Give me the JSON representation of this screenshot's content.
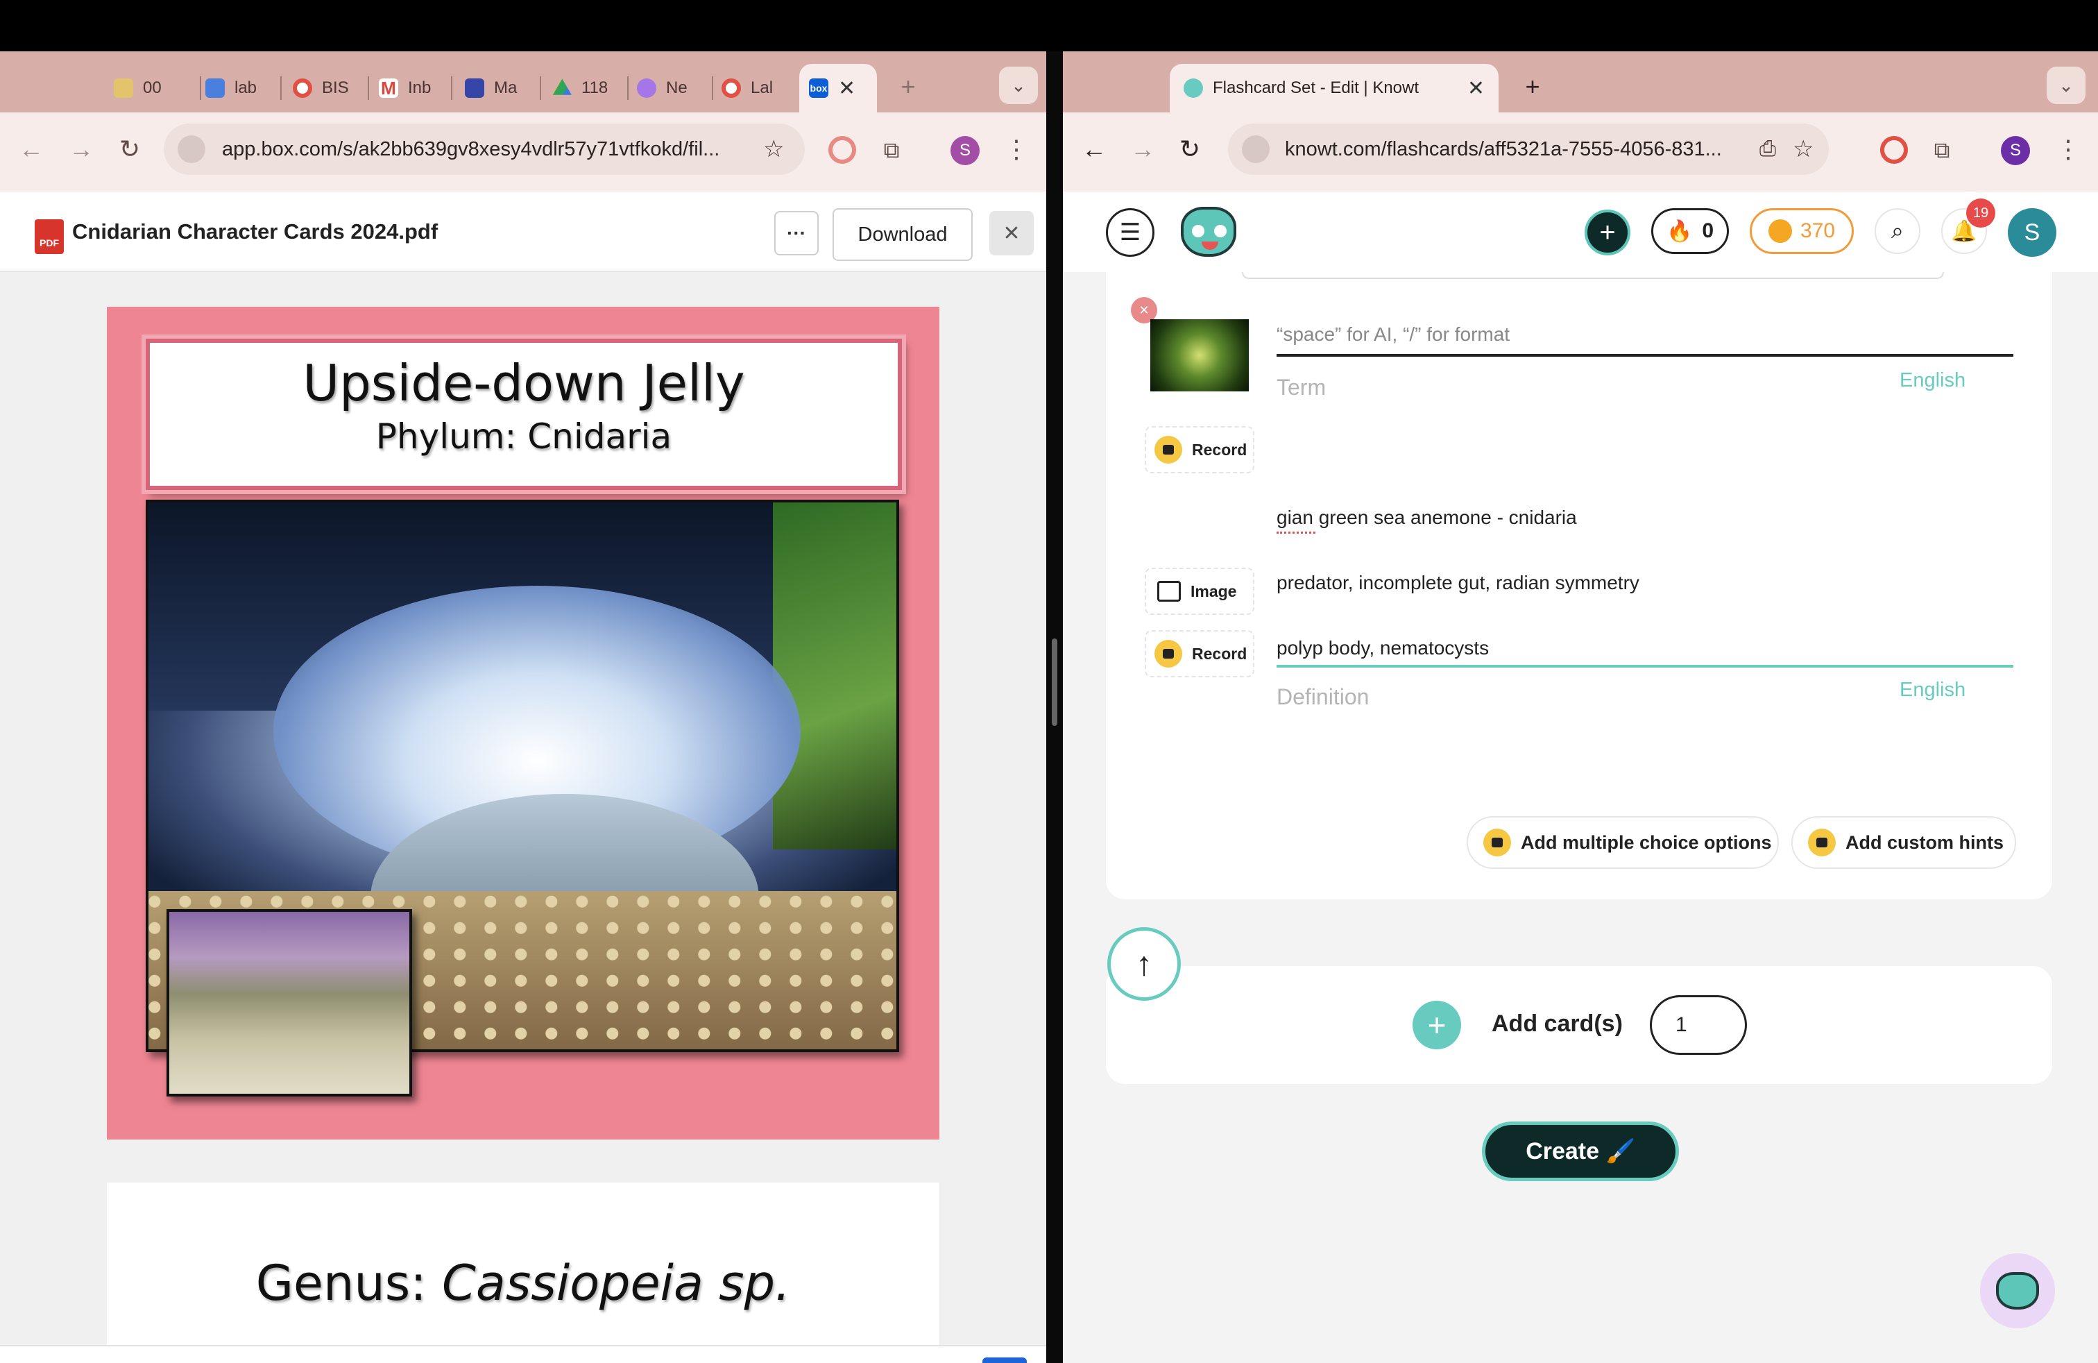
{
  "left": {
    "tabs": [
      {
        "label": "00",
        "icon": "folder-icon",
        "color": "#e3c46c"
      },
      {
        "label": "lab",
        "icon": "docs-icon",
        "color": "#4a7fe0"
      },
      {
        "label": "BIS",
        "icon": "lifebuoy-icon",
        "color": "#e05045"
      },
      {
        "label": "Inb",
        "icon": "gmail-icon",
        "color": "#e0463b"
      },
      {
        "label": "Ma",
        "icon": "forms-icon",
        "color": "#3545a8"
      },
      {
        "label": "118",
        "icon": "drive-icon",
        "color": "#2fa45a"
      },
      {
        "label": "Ne",
        "icon": "knowt-icon",
        "color": "#a576e8"
      },
      {
        "label": "Lal",
        "icon": "lifebuoy-icon",
        "color": "#e05045"
      }
    ],
    "active_tab_favicon": "box",
    "url": "app.box.com/s/ak2bb639gv8xesy4vdlr57y71vtfkokd/fil...",
    "file_title": "Cnidarian Character Cards 2024.pdf",
    "pdf_badge": "PDF",
    "more_button": "···",
    "download_button": "Download",
    "page1": {
      "title": "Upside-down Jelly",
      "subtitle": "Phylum: Cnidaria"
    },
    "page2": {
      "genus_prefix": "Genus: ",
      "genus_name": "Cassiopeia sp."
    },
    "profile_initial": "S"
  },
  "right": {
    "tab_title": "Flashcard Set - Edit | Knowt",
    "url": "knowt.com/flashcards/aff5321a-7555-4056-831...",
    "profile_initial": "S",
    "header": {
      "streak": "0",
      "coins": "370",
      "notifications": "19",
      "avatar": "S"
    },
    "card": {
      "term_placeholder": "“space” for AI, “/” for format",
      "term_label": "Term",
      "term_language": "English",
      "record_label": "Record",
      "image_label": "Image",
      "definition_lines": [
        "gian green sea anemone - cnidaria",
        "predator, incomplete gut, radian symmetry",
        "polyp body, nematocysts"
      ],
      "definition_label": "Definition",
      "definition_language": "English",
      "mc_button": "Add multiple choice options",
      "hints_button": "Add custom hints"
    },
    "add_cards_label": "Add card(s)",
    "add_cards_count": "1",
    "create_button": "Create 🖌️"
  }
}
